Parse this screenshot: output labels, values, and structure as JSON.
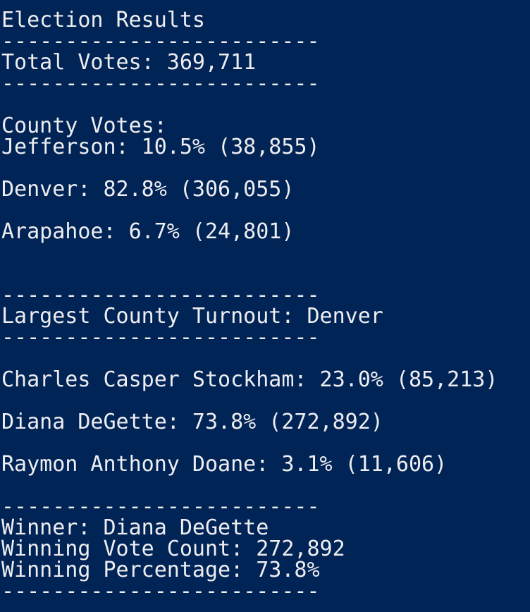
{
  "terminal": {
    "colors": {
      "background": "#012456",
      "foreground": "#eeedf0"
    },
    "lines": {
      "title": "Election Results",
      "sep1": "-------------------------",
      "total_votes": "Total Votes: 369,711",
      "sep2": "-------------------------",
      "county_header": "County Votes:",
      "county_jefferson": "Jefferson: 10.5% (38,855)",
      "county_denver": "Denver: 82.8% (306,055)",
      "county_arapahoe": "Arapahoe: 6.7% (24,801)",
      "sep3": "-------------------------",
      "largest_county": "Largest County Turnout: Denver",
      "sep4": "-------------------------",
      "candidate_stockham": "Charles Casper Stockham: 23.0% (85,213)",
      "candidate_degette": "Diana DeGette: 73.8% (272,892)",
      "candidate_doane": "Raymon Anthony Doane: 3.1% (11,606)",
      "sep5": "-------------------------",
      "winner": "Winner: Diana DeGette",
      "winning_vote_count": "Winning Vote Count: 272,892",
      "winning_percentage": "Winning Percentage: 73.8%",
      "sep6": "-------------------------"
    }
  }
}
